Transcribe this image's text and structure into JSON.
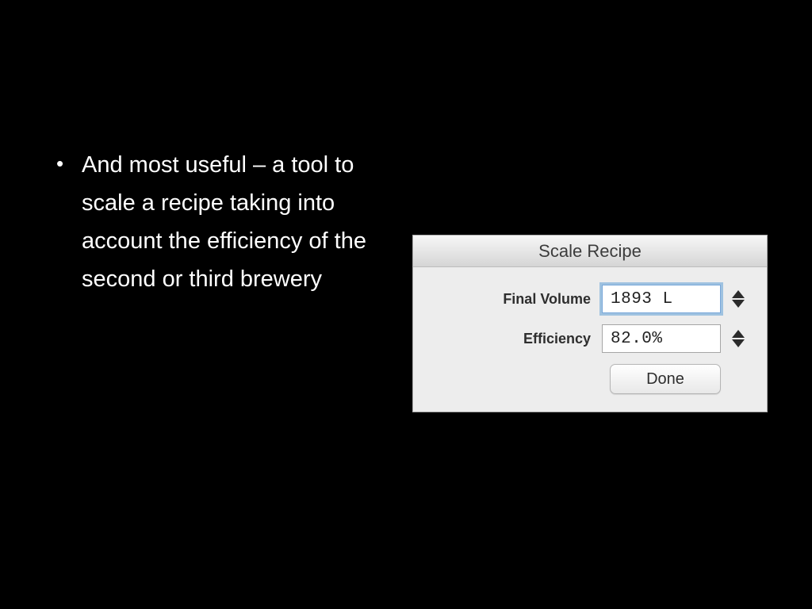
{
  "slide": {
    "bullet": "And most useful – a tool to scale a recipe taking into account the efficiency of the second or third brewery"
  },
  "dialog": {
    "title": "Scale Recipe",
    "fields": {
      "final_volume": {
        "label": "Final Volume",
        "value": "1893 L"
      },
      "efficiency": {
        "label": "Efficiency",
        "value": "82.0%"
      }
    },
    "done_label": "Done"
  }
}
